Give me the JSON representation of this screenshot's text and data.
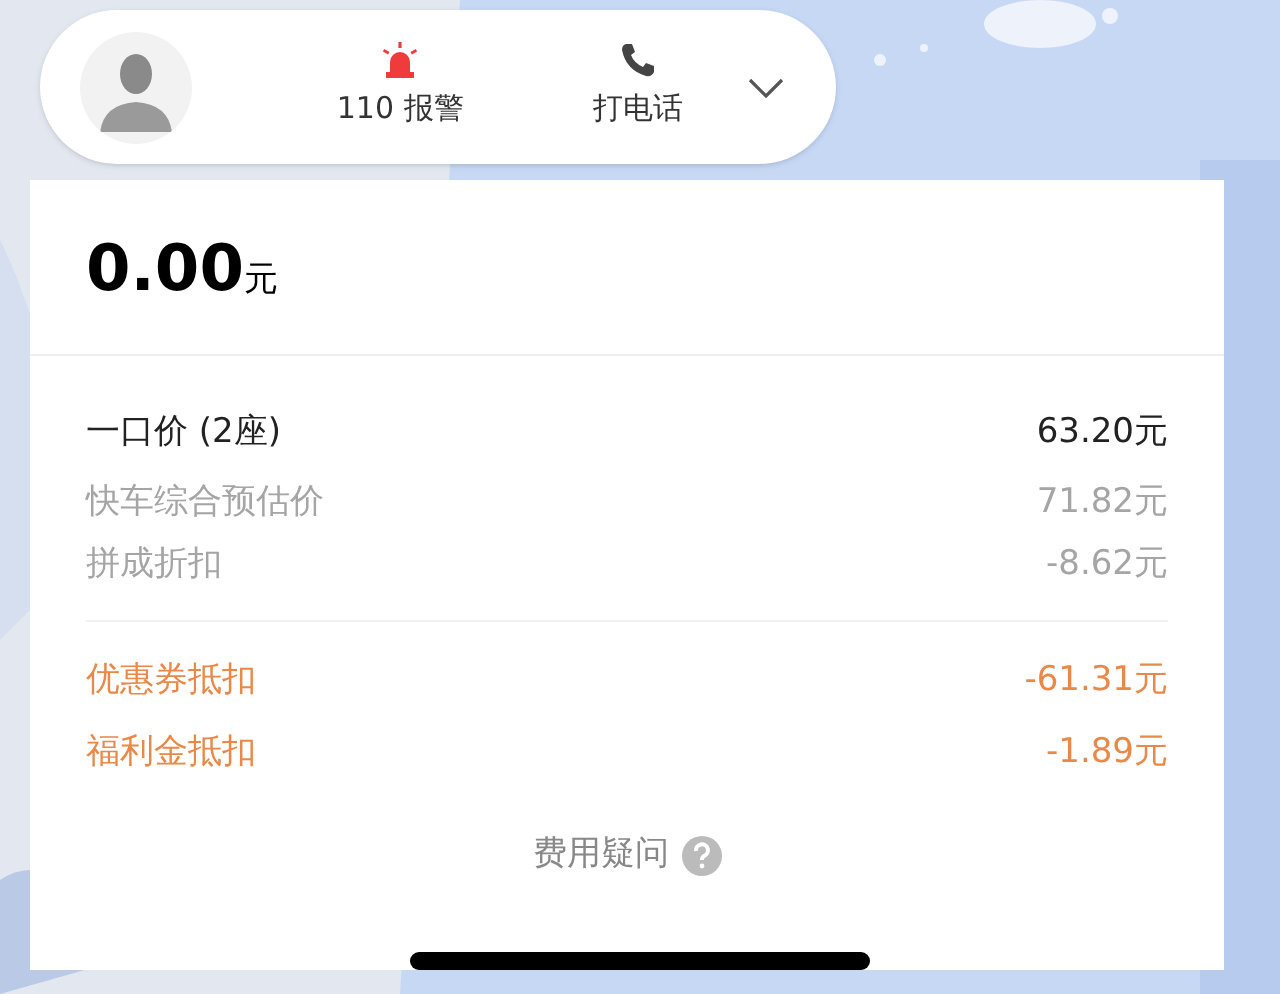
{
  "driver_bar": {
    "actions": [
      {
        "kind": "alarm",
        "label": "110 报警"
      },
      {
        "kind": "phone",
        "label": "打电话"
      }
    ],
    "expanded": false
  },
  "fare": {
    "amount": "0.00",
    "unit": "元"
  },
  "sections": [
    [
      {
        "kind": "main",
        "label": "一口价 (2座)",
        "value": "63.20元"
      },
      {
        "kind": "detail",
        "label": "快车综合预估价",
        "value": "71.82元"
      },
      {
        "kind": "detail",
        "label": "拼成折扣",
        "value": "-8.62元"
      }
    ],
    [
      {
        "kind": "deduction",
        "label": "优惠券抵扣",
        "value": "-61.31元"
      },
      {
        "kind": "deduction",
        "label": "福利金抵扣",
        "value": "-1.89元"
      }
    ]
  ],
  "help_link": "费用疑问"
}
